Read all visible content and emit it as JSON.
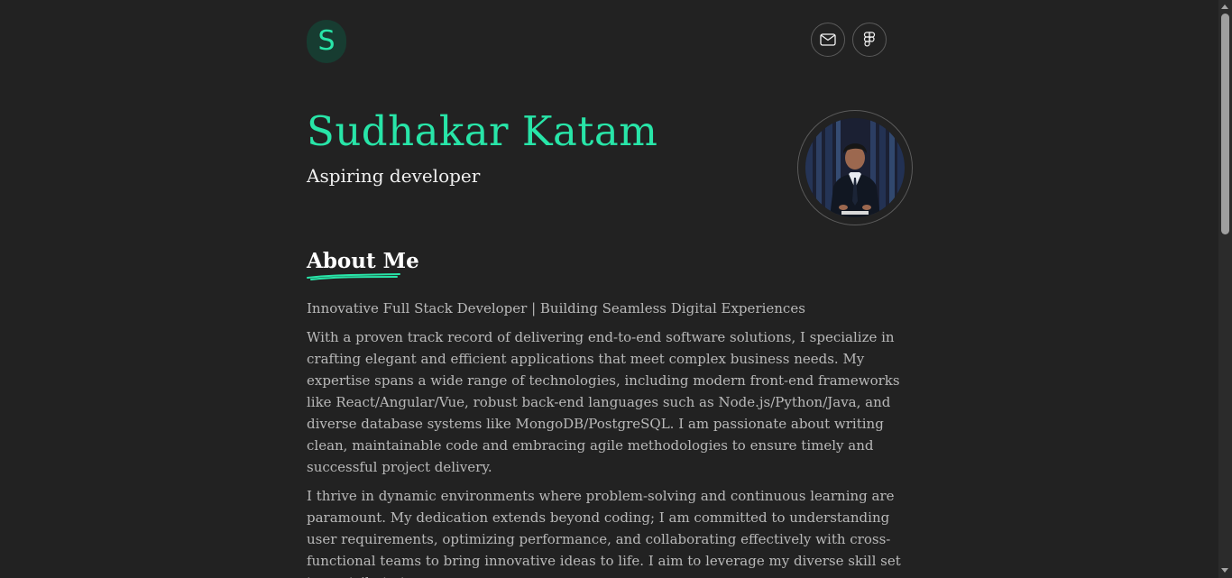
{
  "header": {
    "logo_letter": "S",
    "email_icon": "mail-icon",
    "figma_icon": "figma-icon"
  },
  "hero": {
    "name": "Sudhakar Katam",
    "role": "Aspiring developer",
    "photo": "profile-photo"
  },
  "about": {
    "title": "About Me",
    "paragraphs": [
      "Innovative Full Stack Developer | Building Seamless Digital Experiences",
      "With a proven track record of delivering end-to-end software solutions, I specialize in crafting elegant and efficient applications that meet complex business needs. My expertise spans a wide range of technologies, including modern front-end frameworks like React/Angular/Vue, robust back-end languages such as Node.js/Python/Java, and diverse database systems like MongoDB/PostgreSQL. I am passionate about writing clean, maintainable code and embracing agile methodologies to ensure timely and successful project delivery.",
      "I thrive in dynamic environments where problem-solving and continuous learning are paramount. My dedication extends beyond coding; I am committed to understanding user requirements, optimizing performance, and collaborating effectively with cross-functional teams to bring innovative ideas to life. I aim to leverage my diverse skill set to contribute to"
    ]
  },
  "colors": {
    "background": "#222222",
    "accent": "#28e5a8",
    "text": "#b9b9b9",
    "heading": "#ffffff"
  }
}
